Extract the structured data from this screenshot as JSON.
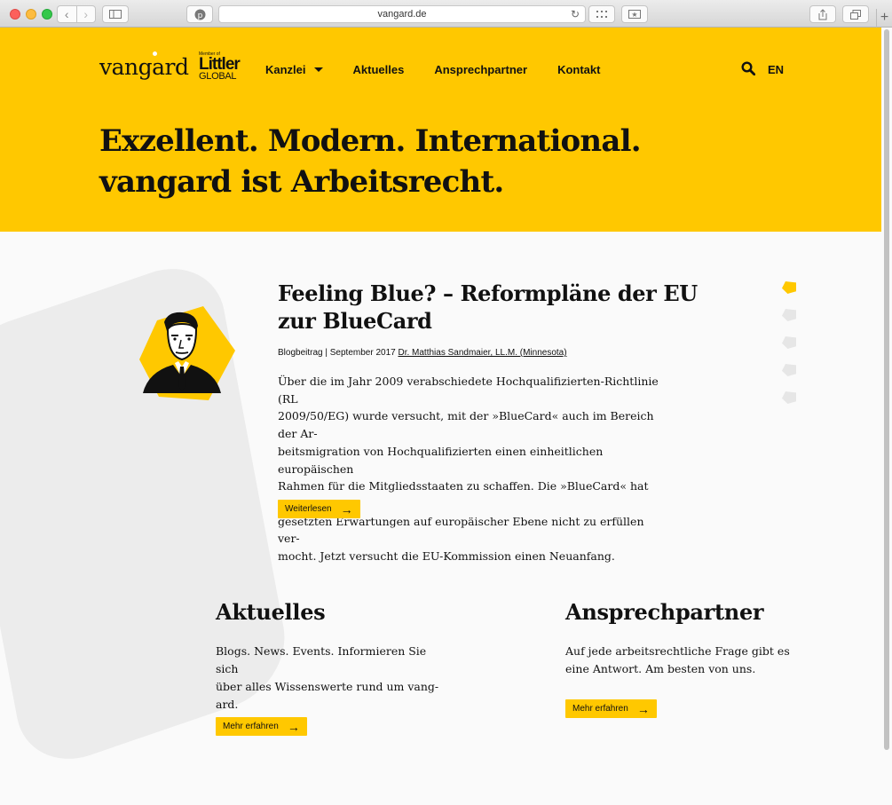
{
  "browser": {
    "url": "vangard.de"
  },
  "header": {
    "logo": "vangard",
    "member_of": "Member of",
    "member_brand": "Littler",
    "member_sub": "GLOBAL",
    "nav": [
      "Kanzlei",
      "Aktuelles",
      "Ansprechpartner",
      "Kontakt"
    ],
    "lang": "EN"
  },
  "hero": {
    "line1": "Exzellent. Modern. International.",
    "line2": "vangard ist Arbeitsrecht."
  },
  "article": {
    "title_line1": "Feeling Blue? – Reformpläne der EU",
    "title_line2": "zur BlueCard",
    "meta": "Blogbeitrag | September 2017",
    "author": "Dr. Matthias Sandmaier, LL.M. (Minnesota)",
    "body_lines": [
      "Über die im Jahr 2009 verabschiedete Hochqualifizierten-Richtlinie (RL",
      "2009/50/EG) wurde versucht, mit der »BlueCard« auch im Bereich der Ar-",
      "beitsmigration von Hochqualifizierten einen einheitlichen europäischen",
      "Rahmen für die Mitgliedsstaaten zu schaffen. Die »BlueCard« hat die in sie",
      "gesetzten Erwartungen auf europäischer Ebene nicht zu erfüllen ver-",
      "mocht. Jetzt versucht die EU-Kommission einen Neuanfang."
    ],
    "read_more": "Weiterlesen"
  },
  "aktuelles": {
    "title": "Aktuelles",
    "lines": [
      "Blogs. News. Events. Informieren Sie sich",
      "über alles Wissenswerte rund um vang-",
      "ard."
    ],
    "button": "Mehr erfahren"
  },
  "ansprechpartner": {
    "title": "Ansprechpartner",
    "lines": [
      "Auf jede arbeitsrechtliche Frage gibt es",
      "eine Antwort. Am besten von uns."
    ],
    "button": "Mehr erfahren"
  },
  "icons": {
    "search": "search-icon",
    "arrow": "arrow-right-icon",
    "caret": "caret-down-icon"
  },
  "colors": {
    "accent": "#ffc800",
    "text": "#111111",
    "background": "#fafafa",
    "shape": "#ececec"
  }
}
